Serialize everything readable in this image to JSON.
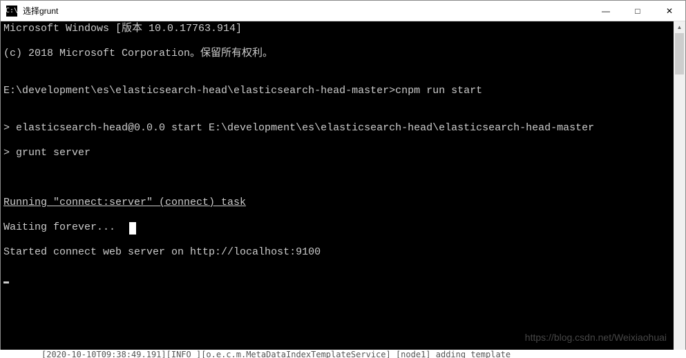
{
  "window": {
    "title": "选择grunt",
    "icon_label": "C:\\"
  },
  "controls": {
    "minimize": "—",
    "maximize": "□",
    "close": "✕"
  },
  "terminal": {
    "lines": [
      "Microsoft Windows [版本 10.0.17763.914]",
      "(c) 2018 Microsoft Corporation。保留所有权利。",
      "",
      "E:\\development\\es\\elasticsearch-head\\elasticsearch-head-master>cnpm run start",
      "",
      "> elasticsearch-head@0.0.0 start E:\\development\\es\\elasticsearch-head\\elasticsearch-head-master",
      "> grunt server",
      "",
      "",
      "Running \"connect:server\" (connect) task",
      "Waiting forever...",
      "Started connect web server on http://localhost:9100"
    ],
    "underline_index": 9
  },
  "watermark": "https://blog.csdn.net/Weixiaohuai",
  "bottom_clip": "[2020-10-10T09:38:49.191][INFO ][o.e.c.m.MetaDataIndexTemplateService] [node1] adding template"
}
